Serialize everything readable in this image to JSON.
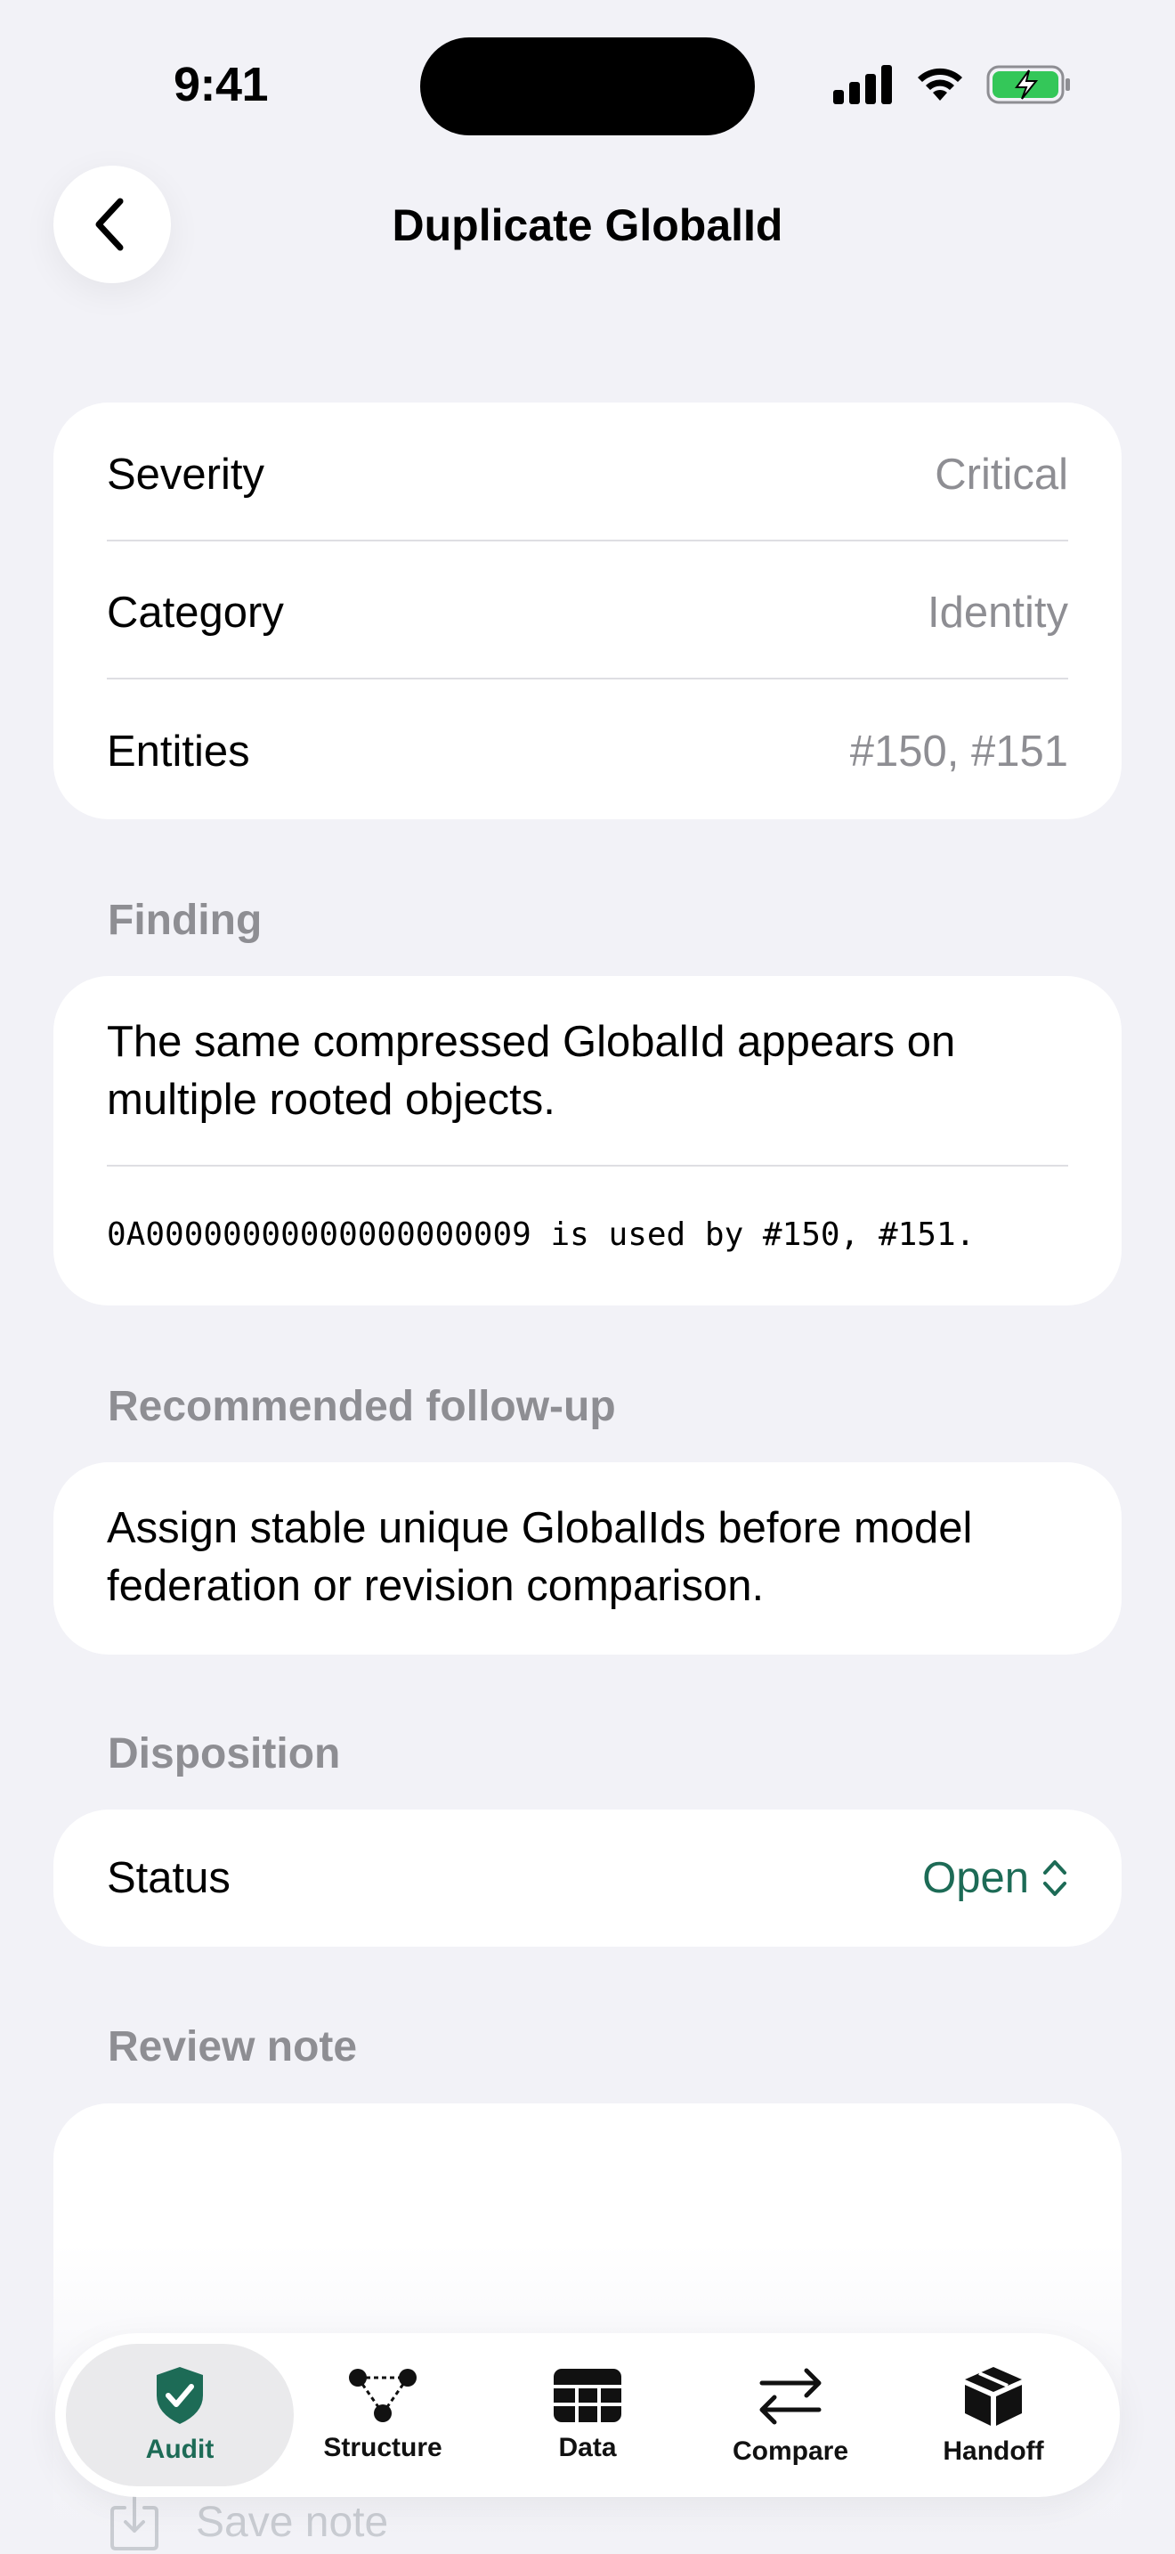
{
  "status_bar": {
    "time": "9:41"
  },
  "nav": {
    "title": "Duplicate GlobalId",
    "back_icon": "chevron-left-icon"
  },
  "details": [
    {
      "label": "Severity",
      "value": "Critical"
    },
    {
      "label": "Category",
      "value": "Identity"
    },
    {
      "label": "Entities",
      "value": "#150, #151"
    }
  ],
  "finding": {
    "header": "Finding",
    "line1": "The same compressed GlobalId appears on",
    "line2": "multiple rooted objects.",
    "detail": "0A00000000000000000009 is used by #150, #151."
  },
  "followup": {
    "header": "Recommended follow-up",
    "line1": "Assign stable unique GlobalIds before model",
    "line2": "federation or revision comparison."
  },
  "disposition": {
    "header": "Disposition",
    "label": "Status",
    "value": "Open",
    "accent_color": "#1d6b56"
  },
  "review_note": {
    "header": "Review note",
    "save_label": "Save note"
  },
  "tabs": [
    {
      "label": "Audit",
      "icon": "shield-check-icon",
      "active": true
    },
    {
      "label": "Structure",
      "icon": "structure-graph-icon",
      "active": false
    },
    {
      "label": "Data",
      "icon": "table-grid-icon",
      "active": false
    },
    {
      "label": "Compare",
      "icon": "arrows-swap-icon",
      "active": false
    },
    {
      "label": "Handoff",
      "icon": "package-box-icon",
      "active": false
    }
  ]
}
